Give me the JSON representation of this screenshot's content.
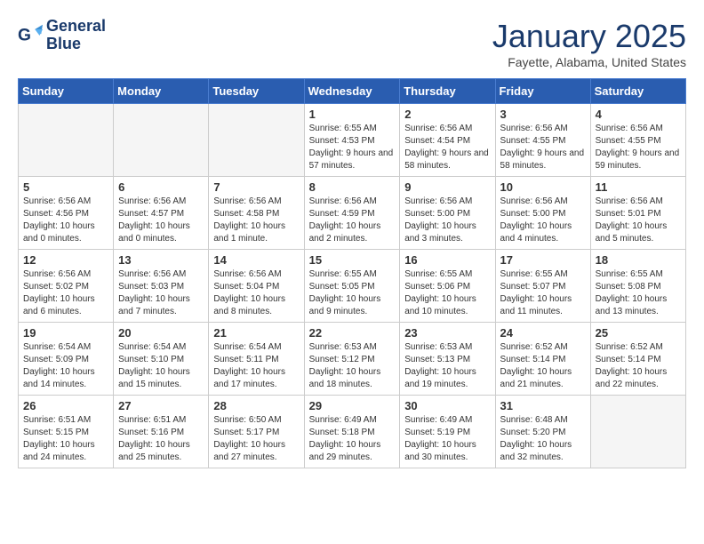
{
  "header": {
    "logo_line1": "General",
    "logo_line2": "Blue",
    "month": "January 2025",
    "location": "Fayette, Alabama, United States"
  },
  "weekdays": [
    "Sunday",
    "Monday",
    "Tuesday",
    "Wednesday",
    "Thursday",
    "Friday",
    "Saturday"
  ],
  "weeks": [
    [
      {
        "day": "",
        "info": ""
      },
      {
        "day": "",
        "info": ""
      },
      {
        "day": "",
        "info": ""
      },
      {
        "day": "1",
        "info": "Sunrise: 6:55 AM\nSunset: 4:53 PM\nDaylight: 9 hours\nand 57 minutes."
      },
      {
        "day": "2",
        "info": "Sunrise: 6:56 AM\nSunset: 4:54 PM\nDaylight: 9 hours\nand 58 minutes."
      },
      {
        "day": "3",
        "info": "Sunrise: 6:56 AM\nSunset: 4:55 PM\nDaylight: 9 hours\nand 58 minutes."
      },
      {
        "day": "4",
        "info": "Sunrise: 6:56 AM\nSunset: 4:55 PM\nDaylight: 9 hours\nand 59 minutes."
      }
    ],
    [
      {
        "day": "5",
        "info": "Sunrise: 6:56 AM\nSunset: 4:56 PM\nDaylight: 10 hours\nand 0 minutes."
      },
      {
        "day": "6",
        "info": "Sunrise: 6:56 AM\nSunset: 4:57 PM\nDaylight: 10 hours\nand 0 minutes."
      },
      {
        "day": "7",
        "info": "Sunrise: 6:56 AM\nSunset: 4:58 PM\nDaylight: 10 hours\nand 1 minute."
      },
      {
        "day": "8",
        "info": "Sunrise: 6:56 AM\nSunset: 4:59 PM\nDaylight: 10 hours\nand 2 minutes."
      },
      {
        "day": "9",
        "info": "Sunrise: 6:56 AM\nSunset: 5:00 PM\nDaylight: 10 hours\nand 3 minutes."
      },
      {
        "day": "10",
        "info": "Sunrise: 6:56 AM\nSunset: 5:00 PM\nDaylight: 10 hours\nand 4 minutes."
      },
      {
        "day": "11",
        "info": "Sunrise: 6:56 AM\nSunset: 5:01 PM\nDaylight: 10 hours\nand 5 minutes."
      }
    ],
    [
      {
        "day": "12",
        "info": "Sunrise: 6:56 AM\nSunset: 5:02 PM\nDaylight: 10 hours\nand 6 minutes."
      },
      {
        "day": "13",
        "info": "Sunrise: 6:56 AM\nSunset: 5:03 PM\nDaylight: 10 hours\nand 7 minutes."
      },
      {
        "day": "14",
        "info": "Sunrise: 6:56 AM\nSunset: 5:04 PM\nDaylight: 10 hours\nand 8 minutes."
      },
      {
        "day": "15",
        "info": "Sunrise: 6:55 AM\nSunset: 5:05 PM\nDaylight: 10 hours\nand 9 minutes."
      },
      {
        "day": "16",
        "info": "Sunrise: 6:55 AM\nSunset: 5:06 PM\nDaylight: 10 hours\nand 10 minutes."
      },
      {
        "day": "17",
        "info": "Sunrise: 6:55 AM\nSunset: 5:07 PM\nDaylight: 10 hours\nand 11 minutes."
      },
      {
        "day": "18",
        "info": "Sunrise: 6:55 AM\nSunset: 5:08 PM\nDaylight: 10 hours\nand 13 minutes."
      }
    ],
    [
      {
        "day": "19",
        "info": "Sunrise: 6:54 AM\nSunset: 5:09 PM\nDaylight: 10 hours\nand 14 minutes."
      },
      {
        "day": "20",
        "info": "Sunrise: 6:54 AM\nSunset: 5:10 PM\nDaylight: 10 hours\nand 15 minutes."
      },
      {
        "day": "21",
        "info": "Sunrise: 6:54 AM\nSunset: 5:11 PM\nDaylight: 10 hours\nand 17 minutes."
      },
      {
        "day": "22",
        "info": "Sunrise: 6:53 AM\nSunset: 5:12 PM\nDaylight: 10 hours\nand 18 minutes."
      },
      {
        "day": "23",
        "info": "Sunrise: 6:53 AM\nSunset: 5:13 PM\nDaylight: 10 hours\nand 19 minutes."
      },
      {
        "day": "24",
        "info": "Sunrise: 6:52 AM\nSunset: 5:14 PM\nDaylight: 10 hours\nand 21 minutes."
      },
      {
        "day": "25",
        "info": "Sunrise: 6:52 AM\nSunset: 5:14 PM\nDaylight: 10 hours\nand 22 minutes."
      }
    ],
    [
      {
        "day": "26",
        "info": "Sunrise: 6:51 AM\nSunset: 5:15 PM\nDaylight: 10 hours\nand 24 minutes."
      },
      {
        "day": "27",
        "info": "Sunrise: 6:51 AM\nSunset: 5:16 PM\nDaylight: 10 hours\nand 25 minutes."
      },
      {
        "day": "28",
        "info": "Sunrise: 6:50 AM\nSunset: 5:17 PM\nDaylight: 10 hours\nand 27 minutes."
      },
      {
        "day": "29",
        "info": "Sunrise: 6:49 AM\nSunset: 5:18 PM\nDaylight: 10 hours\nand 29 minutes."
      },
      {
        "day": "30",
        "info": "Sunrise: 6:49 AM\nSunset: 5:19 PM\nDaylight: 10 hours\nand 30 minutes."
      },
      {
        "day": "31",
        "info": "Sunrise: 6:48 AM\nSunset: 5:20 PM\nDaylight: 10 hours\nand 32 minutes."
      },
      {
        "day": "",
        "info": ""
      }
    ]
  ]
}
